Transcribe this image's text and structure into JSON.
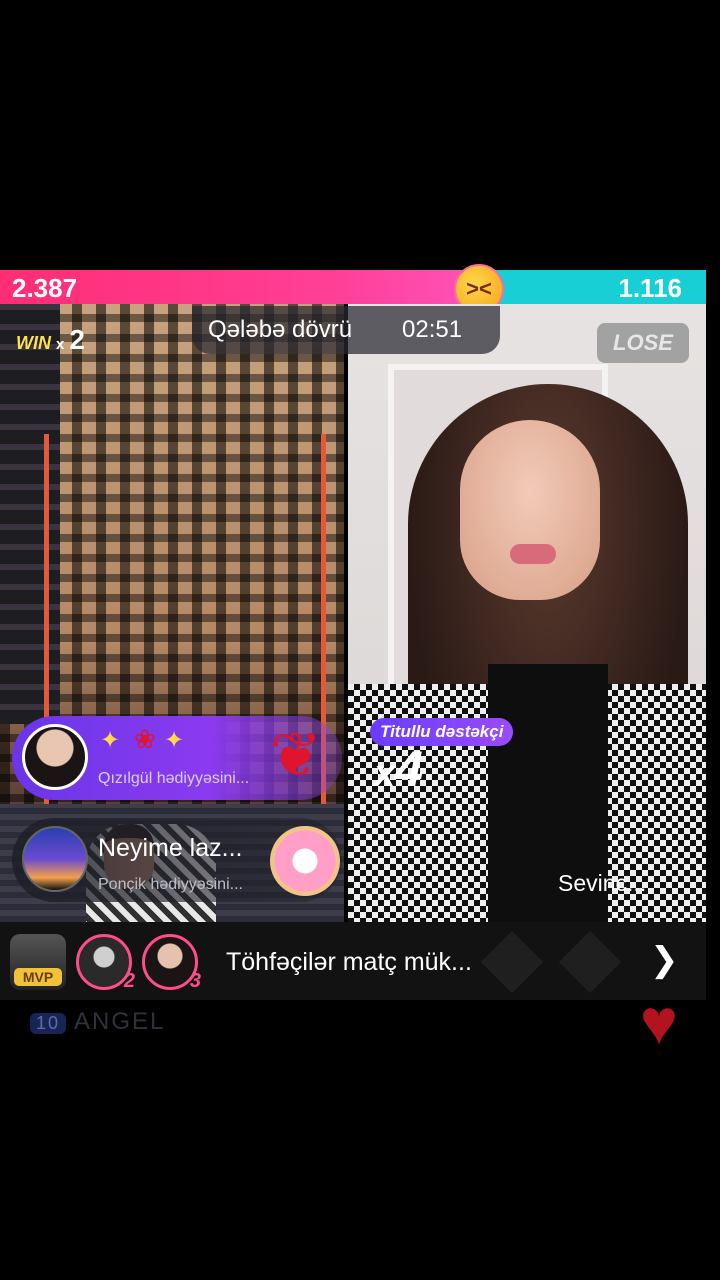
{
  "scores": {
    "left": "2.387",
    "right": "1.116"
  },
  "battle": {
    "win_label": "WIN",
    "win_mult": "x",
    "win_count": "2",
    "phase_label": "Qələbə dövrü",
    "timer": "02:51",
    "lose_label": "LOSE"
  },
  "right_host": {
    "name": "Sevinc...",
    "badge": "Titullu dəstəkçi",
    "multiplier_x": "x",
    "multiplier_n": "4"
  },
  "gifts": [
    {
      "title": "✨🌹✨",
      "subtitle": "Qızılgül  hədiyyəsini...",
      "icon": "rose-icon"
    },
    {
      "title": "Neyime laz...",
      "subtitle": "Ponçik  hədiyyəsini...",
      "icon": "donut-icon"
    }
  ],
  "bottom": {
    "mvp_label": "MVP",
    "rank2": "2",
    "rank3": "3",
    "contributors_label": "Töhfəçilər matç mük..."
  },
  "faded_comment": {
    "level": "10",
    "user": "ANGEL"
  },
  "colors": {
    "left_team": "#ff2d74",
    "right_team": "#18cfd6",
    "accent": "#7a3cf0"
  }
}
